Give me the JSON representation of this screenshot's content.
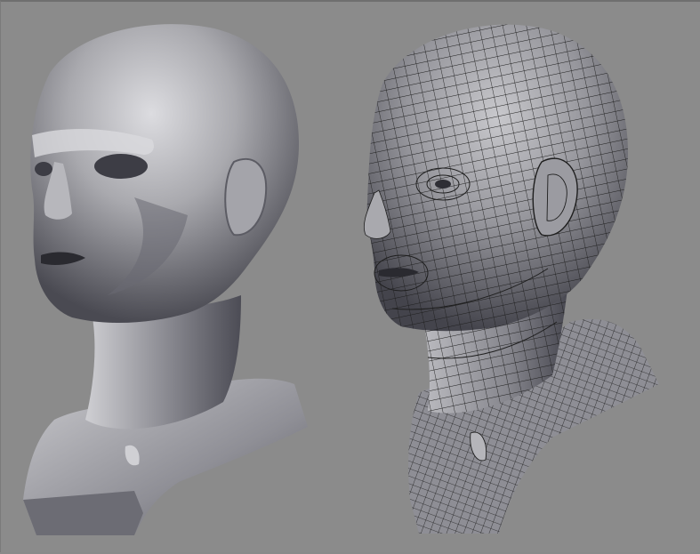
{
  "scene": {
    "background_color": "#8b8b8b",
    "models": [
      {
        "name": "smooth-shaded-head",
        "shading": "smooth",
        "base_color": "#9a9aa0"
      },
      {
        "name": "wireframe-head",
        "shading": "wireframe-on-shaded",
        "base_color": "#8e8e94",
        "wire_color": "#1e1e1e"
      }
    ]
  }
}
